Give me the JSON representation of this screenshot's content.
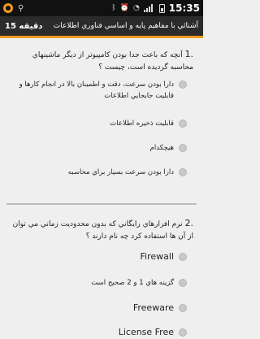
{
  "status_bar": {
    "time": "15:35",
    "icons": [
      "app-logo-icon",
      "usb-icon",
      "bluetooth-icon",
      "alarm-icon",
      "wifi-icon",
      "signal-icon",
      "battery-icon"
    ]
  },
  "header": {
    "timer": "15 دقیقه",
    "title": "آشنائي با مفاهيم پايه و اساسي فناوري اطلاعات"
  },
  "questions": [
    {
      "number": ".1",
      "text": "آنچه که باعث جدا بودن کامپيوتر از ديگر ماشينهاي محاسبه گرديده است، چيست ؟",
      "options": [
        "دارا بودن سرعت، دقت و اطمينان بالا در انجام کارها و قابليت جابجايي اطلاعات",
        "قابليت ذخيره اطلاعات",
        "هيچکدام",
        "دارا بودن سرعت بسيار براي محاسبه"
      ]
    },
    {
      "number": ".2",
      "text": "نرم افزارهاي رايگاني که بدون محدوديت زماني مي توان از آن ها استفاده کرد چه نام دارند ؟",
      "options": [
        "Firewall",
        "گزينه هاي 1 و 2 صحيح است",
        "Freeware",
        "License Free"
      ]
    }
  ],
  "colors": {
    "accent": "#f39a1e",
    "titlebar": "#2b2b2b",
    "background": "#efefef"
  }
}
